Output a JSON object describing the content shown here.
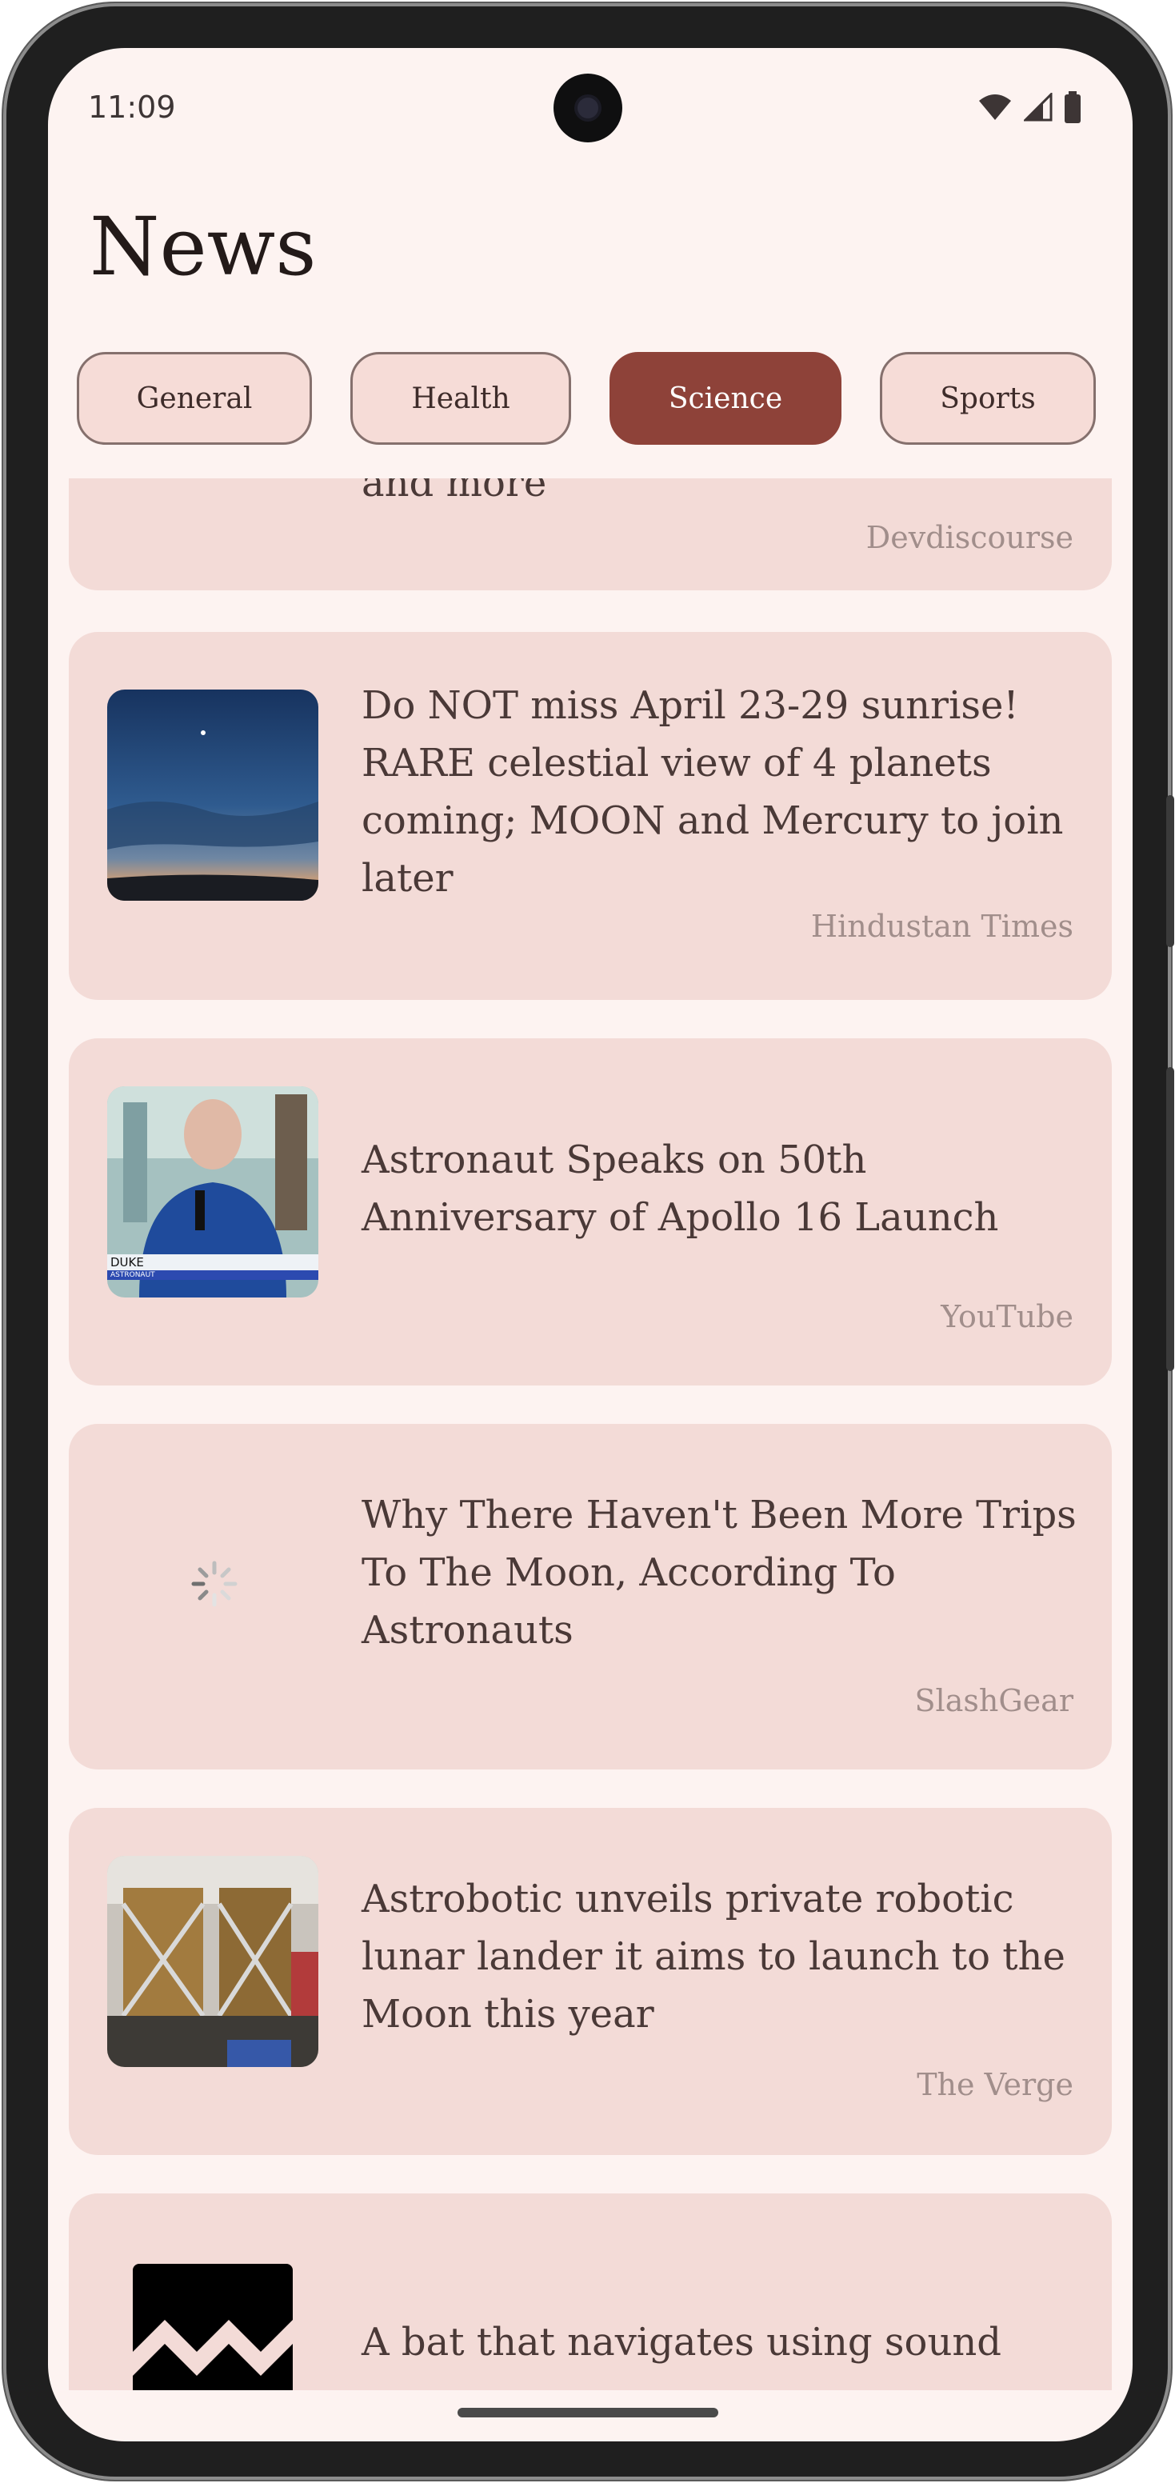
{
  "status_bar": {
    "time": "11:09"
  },
  "app": {
    "title": "News"
  },
  "tabs": [
    {
      "label": "General",
      "active": false
    },
    {
      "label": "Health",
      "active": false
    },
    {
      "label": "Science",
      "active": true
    },
    {
      "label": "Sports",
      "active": false
    }
  ],
  "articles": [
    {
      "headline": "and more",
      "source": "Devdiscourse",
      "thumbnail": "none"
    },
    {
      "headline": "Do NOT miss April 23-29 sunrise! RARE celestial view of 4 planets coming; MOON and Mercury to join later",
      "source": "Hindustan Times",
      "thumbnail": "night-sky-photo"
    },
    {
      "headline": "Astronaut Speaks on 50th Anniversary of Apollo 16 Launch",
      "source": "YouTube",
      "thumbnail": "astronaut-photo"
    },
    {
      "headline": "Why There Haven't Been More Trips To The Moon, According To Astronauts",
      "source": "SlashGear",
      "thumbnail": "loading-spinner"
    },
    {
      "headline": "Astrobotic unveils private robotic lunar lander it aims to launch to the Moon this year",
      "source": "The Verge",
      "thumbnail": "lunar-lander-photo"
    },
    {
      "headline": "A bat that navigates using sound",
      "source": "",
      "thumbnail": "zigzag-logo"
    }
  ],
  "thumbnail_overlay": {
    "name_tag": "DUKE",
    "name_tag_sub": "ASTRONAUT"
  },
  "colors": {
    "background": "#fdf3f1",
    "card": "#f3dbd7",
    "chip_active": "#8e4239",
    "chip": "#f6dcd7",
    "source_text": "#a18e8b"
  }
}
